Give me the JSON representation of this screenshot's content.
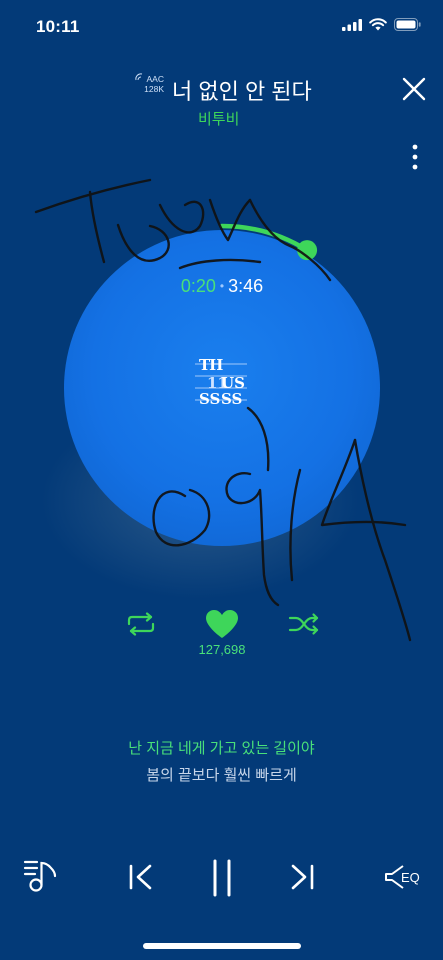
{
  "status_bar": {
    "time": "10:11"
  },
  "header": {
    "quality_line1": "AAC",
    "quality_line2": "128K",
    "title": "너 없인 안 된다",
    "artist": "비투비"
  },
  "player": {
    "current_time": "0:20",
    "separator": "•",
    "total_time": "3:46",
    "progress_fraction": 0.088,
    "album_logo": {
      "line1": "TH",
      "line2": "11",
      "line3": "SS",
      "right1": "US",
      "right2": "SS"
    }
  },
  "actions": {
    "like_count": "127,698"
  },
  "lyrics": {
    "current": "난 지금 네게 가고 있는 길이야",
    "next": "봄의 끝보다 훨씬 빠르게"
  },
  "controls": {
    "eq_label": "EQ"
  },
  "colors": {
    "accent": "#3ed65a",
    "background": "#033a78",
    "disc": "#1471e4"
  }
}
